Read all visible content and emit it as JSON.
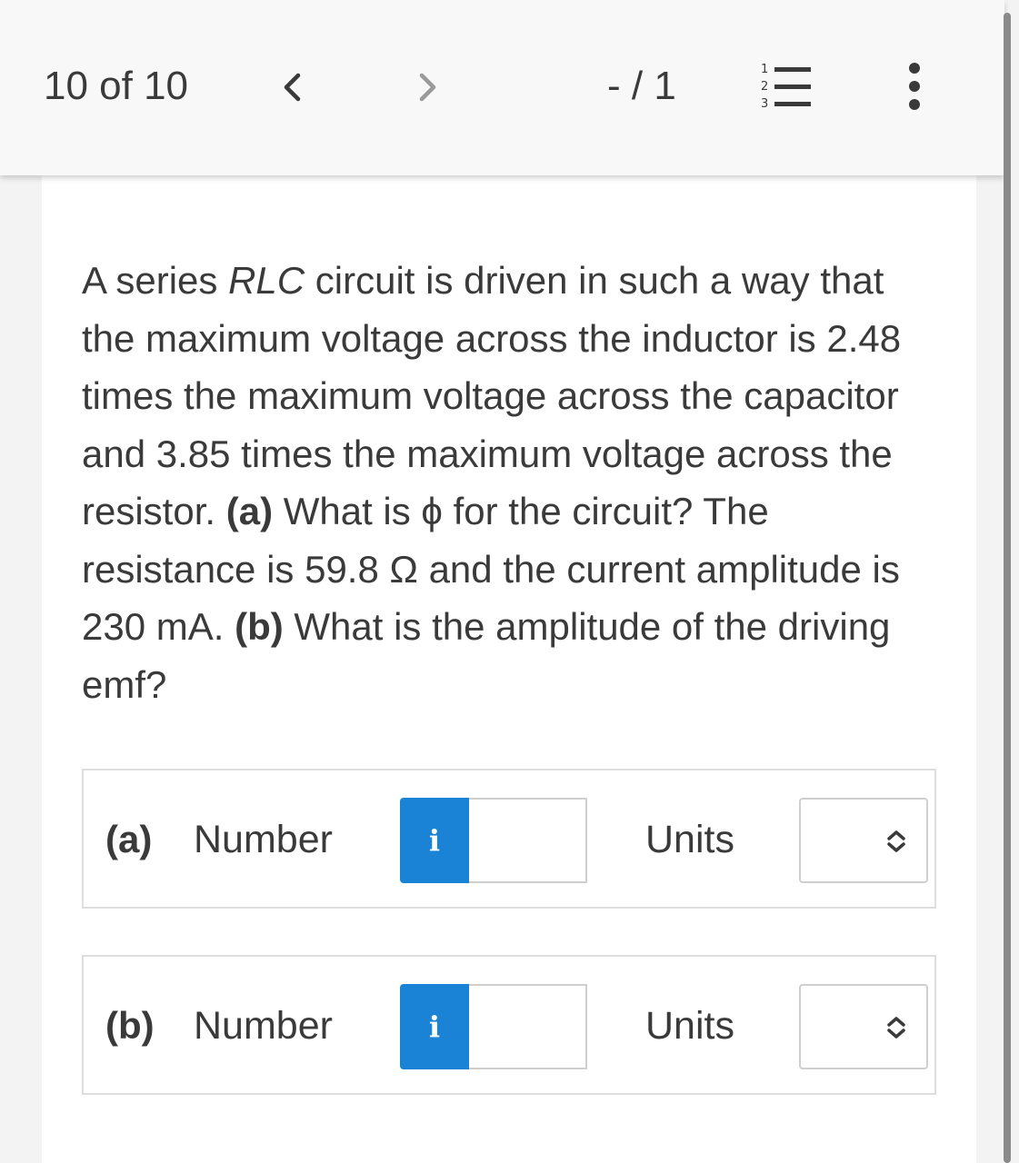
{
  "header": {
    "counter": "10 of 10",
    "score": "- / 1",
    "icons": {
      "prev": "chevron-left-icon",
      "next": "chevron-right-icon",
      "list": "numbered-list-icon",
      "more": "more-vertical-icon"
    }
  },
  "question": {
    "p1": "A series ",
    "p1_em": "RLC",
    "p2": " circuit is driven in such a way that the maximum voltage across the inductor is 2.48 times the maximum voltage across the capacitor and 3.85 times the maximum voltage across the resistor. ",
    "a_label": "(a)",
    "p3": " What is ϕ for the circuit? The resistance is 59.8 Ω and the current amplitude is 230 mA. ",
    "b_label": "(b)",
    "p4": " What is the amplitude of the driving emf?"
  },
  "answers": [
    {
      "part": "(a)",
      "number_label": "Number",
      "info": "i",
      "value": "",
      "units_label": "Units",
      "units_value": ""
    },
    {
      "part": "(b)",
      "number_label": "Number",
      "info": "i",
      "value": "",
      "units_label": "Units",
      "units_value": ""
    }
  ],
  "colors": {
    "info_button": "#1a83d6",
    "text": "#3a3a3a",
    "background": "#f3f3f3"
  }
}
